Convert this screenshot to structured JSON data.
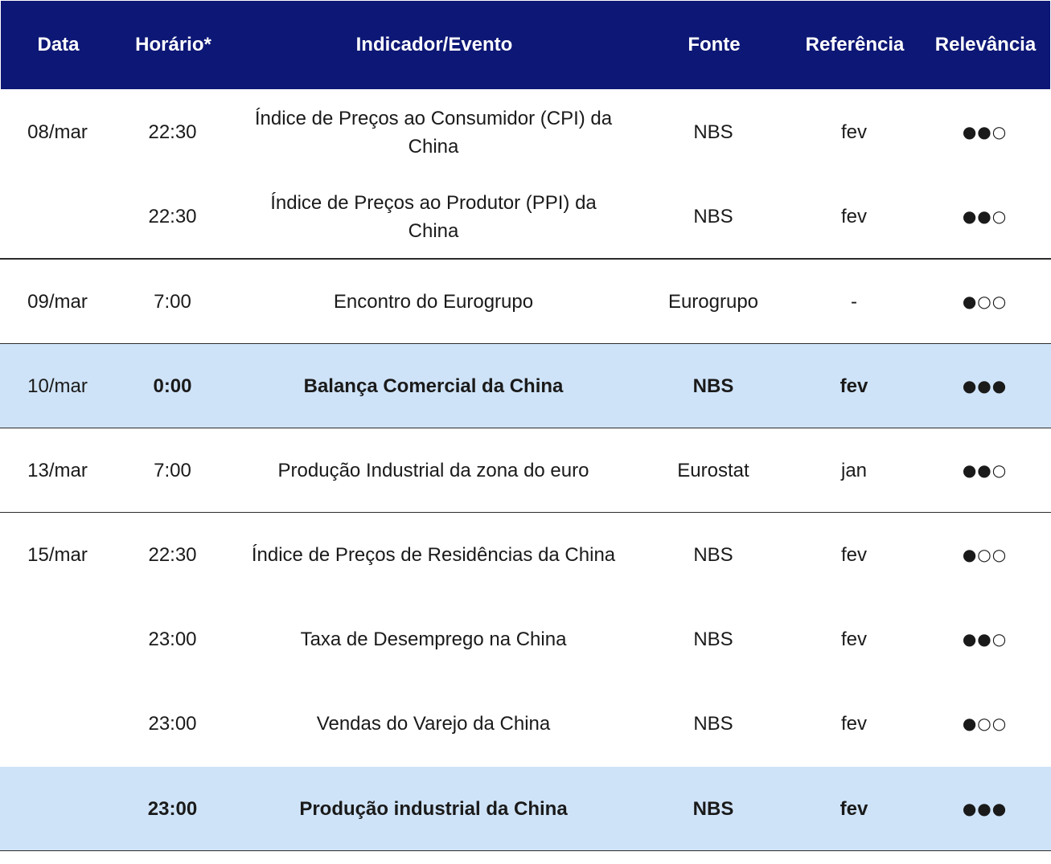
{
  "header": {
    "data": "Data",
    "horario": "Horário*",
    "indicador": "Indicador/Evento",
    "fonte": "Fonte",
    "referencia": "Referência",
    "relevancia": "Relevância"
  },
  "colors": {
    "header_bg": "#0d1775",
    "highlight_bg": "#cfe3f8"
  },
  "rows": [
    {
      "data": "08/mar",
      "horario": "22:30",
      "indicador": "Índice de Preços ao Consumidor (CPI) da China",
      "fonte": "NBS",
      "referencia": "fev",
      "relevancia": "●●○"
    },
    {
      "data": "",
      "horario": "22:30",
      "indicador": "Índice de Preços ao Produtor (PPI) da China",
      "fonte": "NBS",
      "referencia": "fev",
      "relevancia": "●●○"
    },
    {
      "data": "09/mar",
      "horario": "7:00",
      "indicador": "Encontro do Eurogrupo",
      "fonte": "Eurogrupo",
      "referencia": "-",
      "relevancia": "●○○"
    },
    {
      "data": "10/mar",
      "horario": "0:00",
      "indicador": "Balança Comercial da China",
      "fonte": "NBS",
      "referencia": "fev",
      "relevancia": "●●●"
    },
    {
      "data": "13/mar",
      "horario": "7:00",
      "indicador": "Produção Industrial da zona do euro",
      "fonte": "Eurostat",
      "referencia": "jan",
      "relevancia": "●●○"
    },
    {
      "data": "15/mar",
      "horario": "22:30",
      "indicador": "Índice de Preços de Residências da China",
      "fonte": "NBS",
      "referencia": "fev",
      "relevancia": "●○○"
    },
    {
      "data": "",
      "horario": "23:00",
      "indicador": "Taxa de Desemprego na China",
      "fonte": "NBS",
      "referencia": "fev",
      "relevancia": "●●○"
    },
    {
      "data": "",
      "horario": "23:00",
      "indicador": "Vendas do Varejo da China",
      "fonte": "NBS",
      "referencia": "fev",
      "relevancia": "●○○"
    },
    {
      "data": "",
      "horario": "23:00",
      "indicador": "Produção industrial da China",
      "fonte": "NBS",
      "referencia": "fev",
      "relevancia": "●●●"
    }
  ]
}
